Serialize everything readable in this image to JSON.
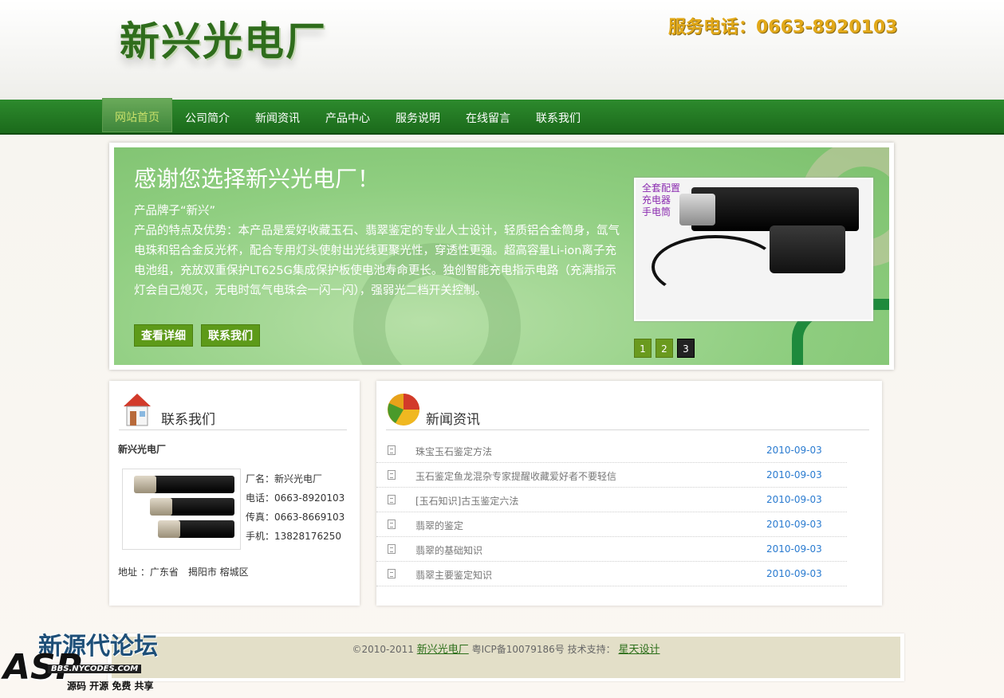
{
  "header": {
    "logo_text": "新兴光电厂",
    "hotline": "服务电话：0663-8920103"
  },
  "nav": {
    "items": [
      {
        "label": "网站首页",
        "active": true
      },
      {
        "label": "公司简介"
      },
      {
        "label": "新闻资讯"
      },
      {
        "label": "产品中心"
      },
      {
        "label": "服务说明"
      },
      {
        "label": "在线留言"
      },
      {
        "label": "联系我们"
      }
    ]
  },
  "banner": {
    "title": "感谢您选择新兴光电厂！",
    "text": "产品牌子“新兴”\n产品的特点及优势：本产品是爱好收藏玉石、翡翠鉴定的专业人士设计，轻质铝合金筒身，氙气电珠和铝合金反光杯，配合专用灯头使射出光线更聚光性，穿透性更强。超高容量Li-ion离子充电池组，充放双重保护LT625G集成保护板使电池寿命更长。独创智能充电指示电路（充满指示灯会自己熄灭，无电时氙气电珠会一闪一闪），强弱光二档开关控制。",
    "detail_button": "查看详细",
    "contact_button": "联系我们",
    "photo_caption": "全套配置\n充电器\n手电筒",
    "pager": [
      "1",
      "2",
      "3"
    ],
    "pager_current": "3"
  },
  "contact": {
    "title": "联系我们",
    "company": "新兴光电厂",
    "lines": [
      "厂名：新兴光电厂",
      "电话：0663-8920103",
      "传真：0663-8669103",
      "手机：13828176250"
    ],
    "address": "地址 ：广东省　揭阳市 榕城区"
  },
  "news": {
    "title": "新闻资讯",
    "items": [
      {
        "title": "珠宝玉石鉴定方法",
        "date": "2010-09-03"
      },
      {
        "title": "玉石鉴定鱼龙混杂专家提醒收藏爱好者不要轻信",
        "date": "2010-09-03"
      },
      {
        "title": "[玉石知识]古玉鉴定六法",
        "date": "2010-09-03"
      },
      {
        "title": "翡翠的鉴定",
        "date": "2010-09-03"
      },
      {
        "title": "翡翠的基础知识",
        "date": "2010-09-03"
      },
      {
        "title": "翡翠主要鉴定知识",
        "date": "2010-09-03"
      }
    ]
  },
  "footer": {
    "copyright": "©2010-2011",
    "site_link": "新兴光电厂",
    "icp": "粤ICP备10079186号",
    "support_label": "技术支持：",
    "support_link": "星天设计"
  },
  "watermark": {
    "title": "新源代论坛",
    "logo": "ASP",
    "url": "BBS.NYCODES.COM",
    "tagline": "源码 开源 免费 共享"
  },
  "colors": {
    "nav_green": "#1b6a1b",
    "banner_green": "#8fce80",
    "accent_gold": "#e2a91a",
    "date_blue": "#2a7bd0"
  }
}
